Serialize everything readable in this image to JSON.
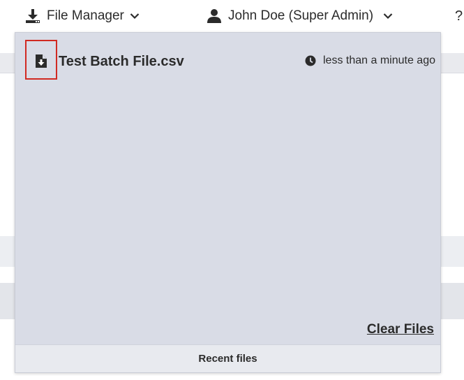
{
  "topbar": {
    "file_manager": {
      "label": "File Manager",
      "icon": "download-tray-icon"
    },
    "user": {
      "label": "John Doe (Super Admin)",
      "icon": "user-icon"
    },
    "help": {
      "label": "?"
    }
  },
  "dropdown": {
    "files": [
      {
        "name": "Test Batch File.csv",
        "time": "less than a minute ago",
        "icon": "file-download-icon"
      }
    ],
    "clear_label": "Clear Files",
    "footer_label": "Recent files"
  },
  "colors": {
    "highlight_border": "#d12a22",
    "panel_bg": "#d9dce6",
    "footer_bg": "#e8eaef"
  }
}
